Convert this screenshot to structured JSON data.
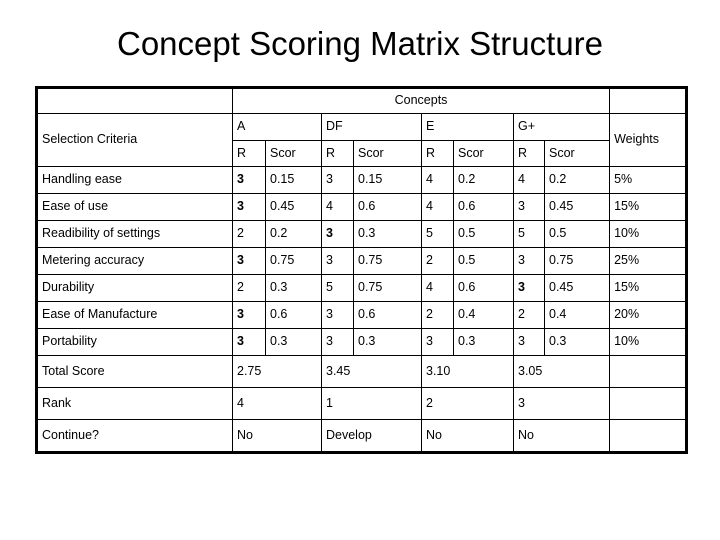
{
  "slide": {
    "title": "Concept Scoring Matrix Structure"
  },
  "table": {
    "group_header": "Concepts",
    "criteria_header": "Selection Criteria",
    "weights_header": "Weights",
    "concepts": [
      "A",
      "DF",
      "E",
      "G+"
    ],
    "sub_headers": [
      "R",
      "Scor"
    ],
    "rows": [
      {
        "criterion": "Handling ease",
        "cells": [
          {
            "r": "3",
            "r_bold": true,
            "score": "0.15"
          },
          {
            "r": "3",
            "r_bold": false,
            "score": "0.15"
          },
          {
            "r": "4",
            "r_bold": false,
            "score": "0.2"
          },
          {
            "r": "4",
            "r_bold": false,
            "score": "0.2"
          }
        ],
        "weight": "5%"
      },
      {
        "criterion": "Ease of use",
        "cells": [
          {
            "r": "3",
            "r_bold": true,
            "score": "0.45"
          },
          {
            "r": "4",
            "r_bold": false,
            "score": "0.6"
          },
          {
            "r": "4",
            "r_bold": false,
            "score": "0.6"
          },
          {
            "r": "3",
            "r_bold": false,
            "score": "0.45"
          }
        ],
        "weight": "15%"
      },
      {
        "criterion": "Readibility of settings",
        "cells": [
          {
            "r": "2",
            "r_bold": false,
            "score": "0.2"
          },
          {
            "r": "3",
            "r_bold": true,
            "score": "0.3"
          },
          {
            "r": "5",
            "r_bold": false,
            "score": "0.5"
          },
          {
            "r": "5",
            "r_bold": false,
            "score": "0.5"
          }
        ],
        "weight": "10%"
      },
      {
        "criterion": "Metering accuracy",
        "cells": [
          {
            "r": "3",
            "r_bold": true,
            "score": "0.75"
          },
          {
            "r": "3",
            "r_bold": false,
            "score": "0.75"
          },
          {
            "r": "2",
            "r_bold": false,
            "score": "0.5"
          },
          {
            "r": "3",
            "r_bold": false,
            "score": "0.75"
          }
        ],
        "weight": "25%"
      },
      {
        "criterion": "Durability",
        "cells": [
          {
            "r": "2",
            "r_bold": false,
            "score": "0.3"
          },
          {
            "r": "5",
            "r_bold": false,
            "score": "0.75"
          },
          {
            "r": "4",
            "r_bold": false,
            "score": "0.6"
          },
          {
            "r": "3",
            "r_bold": true,
            "score": "0.45"
          }
        ],
        "weight": "15%"
      },
      {
        "criterion": "Ease of Manufacture",
        "cells": [
          {
            "r": "3",
            "r_bold": true,
            "score": "0.6"
          },
          {
            "r": "3",
            "r_bold": false,
            "score": "0.6"
          },
          {
            "r": "2",
            "r_bold": false,
            "score": "0.4"
          },
          {
            "r": "2",
            "r_bold": false,
            "score": "0.4"
          }
        ],
        "weight": "20%"
      },
      {
        "criterion": "Portability",
        "cells": [
          {
            "r": "3",
            "r_bold": true,
            "score": "0.3"
          },
          {
            "r": "3",
            "r_bold": false,
            "score": "0.3"
          },
          {
            "r": "3",
            "r_bold": false,
            "score": "0.3"
          },
          {
            "r": "3",
            "r_bold": false,
            "score": "0.3"
          }
        ],
        "weight": "10%"
      }
    ],
    "summary": [
      {
        "label": "Total Score",
        "values": [
          "2.75",
          "3.45",
          "3.10",
          "3.05"
        ],
        "weight": ""
      },
      {
        "label": "Rank",
        "values": [
          "4",
          "1",
          "2",
          "3"
        ],
        "weight": ""
      },
      {
        "label": "Continue?",
        "values": [
          "No",
          "Develop",
          "No",
          "No"
        ],
        "weight": ""
      }
    ]
  },
  "chart_data": {
    "type": "table",
    "title": "Concept Scoring Matrix Structure",
    "columns": [
      "Selection Criteria",
      "A R",
      "A Scor",
      "DF R",
      "DF Scor",
      "E R",
      "E Scor",
      "G+ R",
      "G+ Scor",
      "Weights"
    ],
    "rows": [
      [
        "Handling ease",
        "3",
        "0.15",
        "3",
        "0.15",
        "4",
        "0.2",
        "4",
        "0.2",
        "5%"
      ],
      [
        "Ease of use",
        "3",
        "0.45",
        "4",
        "0.6",
        "4",
        "0.6",
        "3",
        "0.45",
        "15%"
      ],
      [
        "Readibility of settings",
        "2",
        "0.2",
        "3",
        "0.3",
        "5",
        "0.5",
        "5",
        "0.5",
        "10%"
      ],
      [
        "Metering accuracy",
        "3",
        "0.75",
        "3",
        "0.75",
        "2",
        "0.5",
        "3",
        "0.75",
        "25%"
      ],
      [
        "Durability",
        "2",
        "0.3",
        "5",
        "0.75",
        "4",
        "0.6",
        "3",
        "0.45",
        "15%"
      ],
      [
        "Ease of Manufacture",
        "3",
        "0.6",
        "3",
        "0.6",
        "2",
        "0.4",
        "2",
        "0.4",
        "20%"
      ],
      [
        "Portability",
        "3",
        "0.3",
        "3",
        "0.3",
        "3",
        "0.3",
        "3",
        "0.3",
        "10%"
      ],
      [
        "Total Score",
        "2.75",
        "",
        "3.45",
        "",
        "3.10",
        "",
        "3.05",
        "",
        ""
      ],
      [
        "Rank",
        "4",
        "",
        "1",
        "",
        "2",
        "",
        "3",
        "",
        ""
      ],
      [
        "Continue?",
        "No",
        "",
        "Develop",
        "",
        "No",
        "",
        "No",
        "",
        ""
      ]
    ]
  }
}
